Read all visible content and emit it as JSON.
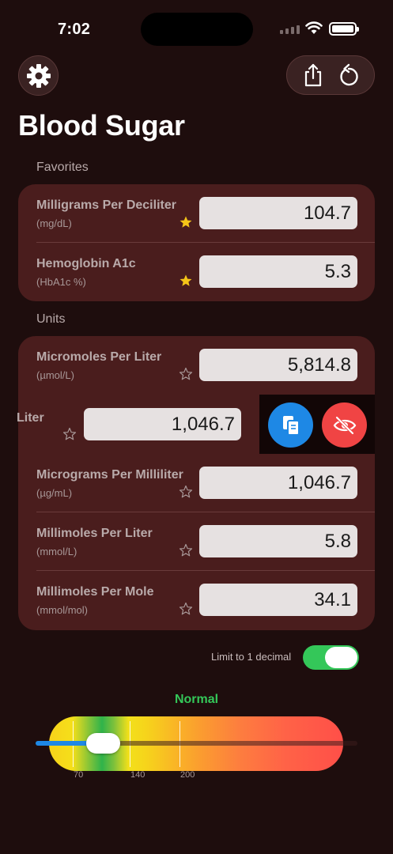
{
  "status_bar": {
    "time": "7:02"
  },
  "header": {
    "title": "Blood Sugar",
    "settings_icon": "gear-icon",
    "share_icon": "share-icon",
    "reset_icon": "reset-icon"
  },
  "favorites": {
    "header": "Favorites",
    "rows": [
      {
        "name": "Milligrams Per Deciliter",
        "abbr": "(mg/dL)",
        "value": "104.7",
        "favorite": true
      },
      {
        "name": "Hemoglobin A1c",
        "abbr": "(HbA1c %)",
        "value": "5.3",
        "favorite": true
      }
    ]
  },
  "units": {
    "header": "Units",
    "rows": [
      {
        "name": "Micromoles Per Liter",
        "abbr": "(µmol/L)",
        "value": "5,814.8",
        "favorite": false
      },
      {
        "name": "Liter",
        "value": "1,046.7",
        "favorite": false,
        "swiped": true
      },
      {
        "name": "Micrograms Per Milliliter",
        "abbr": "(µg/mL)",
        "value": "1,046.7",
        "favorite": false
      },
      {
        "name": "Millimoles Per Liter",
        "abbr": "(mmol/L)",
        "value": "5.8",
        "favorite": false
      },
      {
        "name": "Millimoles Per Mole",
        "abbr": "(mmol/mol)",
        "value": "34.1",
        "favorite": false
      }
    ],
    "swipe_actions": [
      {
        "name": "copy",
        "icon": "copy-icon",
        "color": "#1e88e5"
      },
      {
        "name": "hide",
        "icon": "eye-slash-icon",
        "color": "#f04444"
      }
    ]
  },
  "settings": {
    "decimal_label": "Limit to 1 decimal",
    "decimal_enabled": true
  },
  "range": {
    "status": "Normal",
    "status_color": "#34c759",
    "ticks": [
      "70",
      "140",
      "200"
    ],
    "slider_value": 104.7
  },
  "colors": {
    "background": "#1e0d0d",
    "card": "#4a1d1d",
    "star": "#f5c518"
  }
}
